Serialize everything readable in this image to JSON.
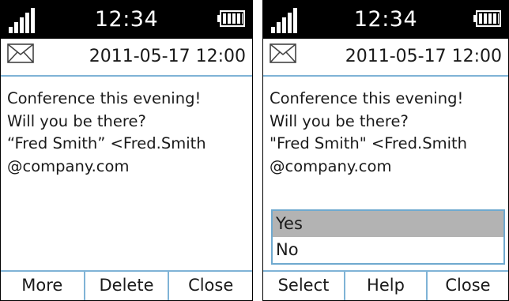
{
  "screens": [
    {
      "status": {
        "time": "12:34"
      },
      "message": {
        "datetime": "2011-05-17 12:00",
        "lines": [
          "Conference this evening!",
          "Will you be there?",
          "“Fred Smith” <Fred.Smith",
          "@company.com"
        ]
      },
      "softkeys": [
        "More",
        "Delete",
        "Close"
      ]
    },
    {
      "status": {
        "time": "12:34"
      },
      "message": {
        "datetime": "2011-05-17 12:00",
        "lines": [
          "Conference this evening!",
          "Will you be there?",
          "\"Fred Smith\" <Fred.Smith",
          "@company.com"
        ]
      },
      "reply_options": {
        "items": [
          "Yes",
          "No"
        ],
        "selected": "Yes"
      },
      "softkeys": [
        "Select",
        "Help",
        "Close"
      ]
    }
  ],
  "icons": {
    "signal": "signal-strength-icon",
    "battery": "battery-icon",
    "message": "envelope-icon"
  },
  "colors": {
    "status_bar": "#000000",
    "divider": "#7fb3d6",
    "selection": "#b3b3b3"
  }
}
